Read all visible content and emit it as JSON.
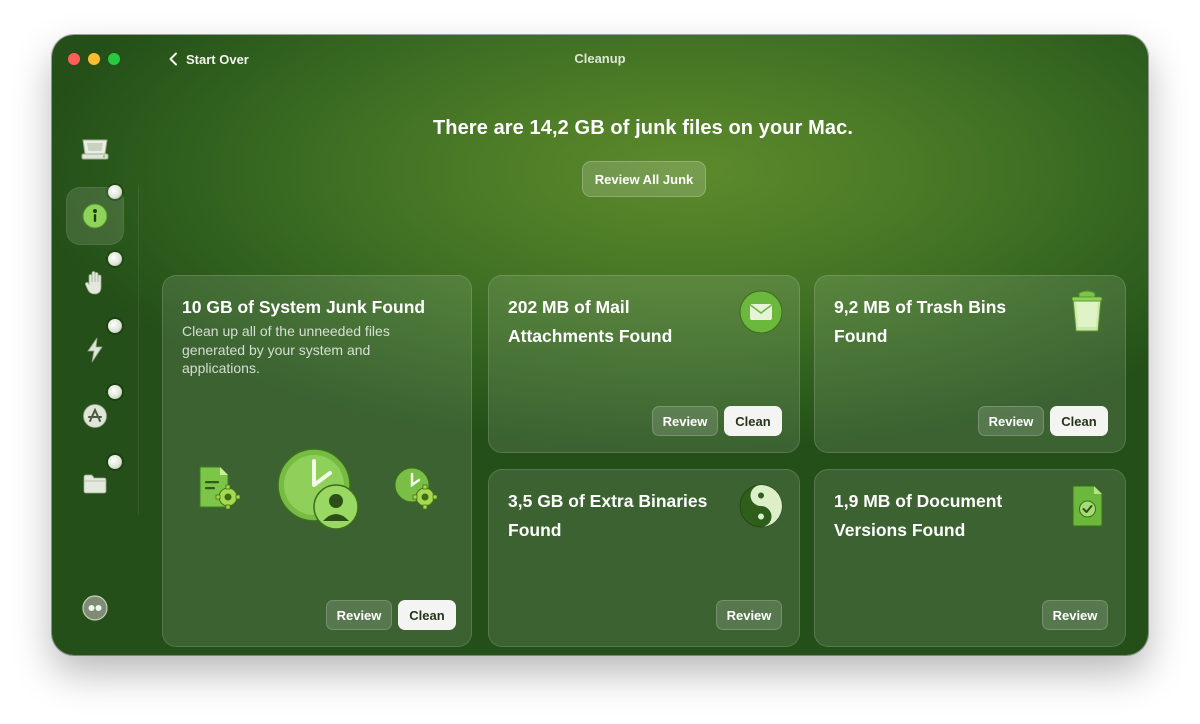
{
  "window": {
    "title": "Cleanup",
    "back_label": "Start Over"
  },
  "sidebar": {
    "items": [
      {
        "icon": "disk-icon",
        "active": false
      },
      {
        "icon": "cleanup-icon",
        "active": true
      },
      {
        "icon": "hand-icon",
        "active": false
      },
      {
        "icon": "speed-icon",
        "active": false
      },
      {
        "icon": "applications-icon",
        "active": false
      },
      {
        "icon": "folder-icon",
        "active": false
      }
    ],
    "bottom_icon": "assistant-icon"
  },
  "main": {
    "headline": "There are 14,2 GB of junk files on your Mac.",
    "review_all_label": "Review All Junk"
  },
  "cards": {
    "system_junk": {
      "title": "10 GB of System Junk Found",
      "description": "Clean up all of the unneeded files generated by your system and applications.",
      "review_label": "Review",
      "clean_label": "Clean"
    },
    "mail": {
      "title_line1": "202 MB of Mail",
      "title_line2": "Attachments Found",
      "icon": "mail-icon",
      "review_label": "Review",
      "clean_label": "Clean"
    },
    "trash": {
      "title_line1": "9,2 MB of Trash Bins",
      "title_line2": "Found",
      "icon": "trash-icon",
      "review_label": "Review",
      "clean_label": "Clean"
    },
    "binaries": {
      "title_line1": "3,5 GB of Extra Binaries",
      "title_line2": "Found",
      "icon": "binaries-icon",
      "review_label": "Review"
    },
    "documents": {
      "title_line1": "1,9 MB of Document",
      "title_line2": "Versions Found",
      "icon": "document-check-icon",
      "review_label": "Review"
    }
  },
  "colors": {
    "window_bg": "#3a6b22",
    "accent_green": "#6fbf3e",
    "clean_button": "#f4f5f2"
  }
}
